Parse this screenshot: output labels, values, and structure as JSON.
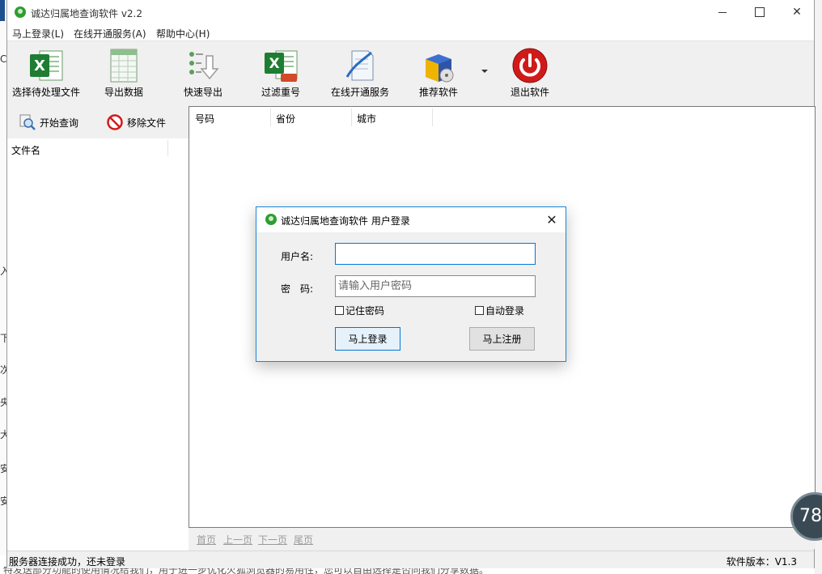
{
  "window": {
    "title": "诚达归属地查询软件 v2.2"
  },
  "menu": [
    "马上登录(L)",
    "在线开通服务(A)",
    "帮助中心(H)"
  ],
  "toolbar": [
    {
      "label": "选择待处理文件",
      "icon": "excel-file-icon"
    },
    {
      "label": "导出数据",
      "icon": "spreadsheet-icon"
    },
    {
      "label": "快速导出",
      "icon": "fast-export-icon"
    },
    {
      "label": "过滤重号",
      "icon": "excel-filter-icon"
    },
    {
      "label": "在线开通服务",
      "icon": "online-service-icon"
    },
    {
      "label": "推荐软件",
      "icon": "software-box-icon"
    },
    {
      "label": "退出软件",
      "icon": "power-icon"
    }
  ],
  "left_actions": {
    "start_query": "开始查询",
    "remove_file": "移除文件"
  },
  "file_list": {
    "column": "文件名"
  },
  "grid": {
    "columns": [
      "号码",
      "省份",
      "城市"
    ]
  },
  "pager": [
    "首页",
    "上一页",
    "下一页",
    "尾页"
  ],
  "status": {
    "connection": "服务器连接成功，还未登录",
    "version": "软件版本：V1.3"
  },
  "widget": {
    "value": "78"
  },
  "background": {
    "left_fragments": [
      "C",
      "入",
      "下",
      "次",
      "央",
      "大",
      "安",
      "安"
    ],
    "bottom_text": "特发送部分功能的使用情况给我们，用于进一步优化火狐浏览器的易用性，您可以自由选择是否向我们分享数据。"
  },
  "colors": {
    "accent": "#0078d7",
    "dialog_border": "#1b86d8",
    "excel_green": "#1e7d32",
    "power_red": "#d01a1a"
  },
  "login_dialog": {
    "title": "诚达归属地查询软件 用户登录",
    "username_label": "用户名:",
    "username_value": "",
    "password_label": "密　码:",
    "password_placeholder": "请输入用户密码",
    "remember": "记住密码",
    "auto_login": "自动登录",
    "login_button": "马上登录",
    "register_button": "马上注册"
  }
}
